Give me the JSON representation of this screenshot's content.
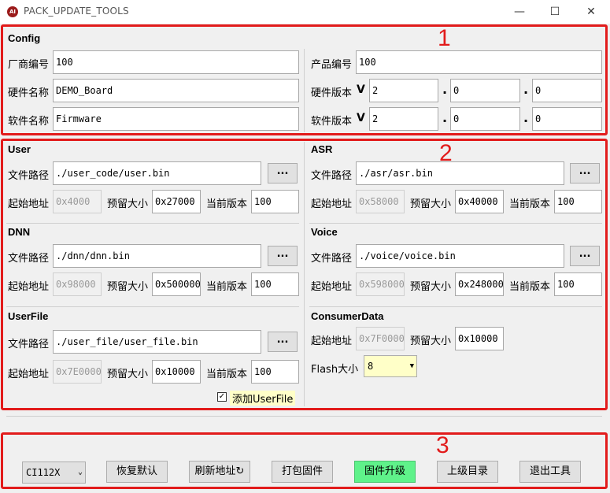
{
  "window": {
    "title": "PACK_UPDATE_TOOLS",
    "icon_text": "AI",
    "minimize": "—",
    "maximize": "☐",
    "close": "✕"
  },
  "markers": {
    "one": "1",
    "two": "2",
    "three": "3"
  },
  "config": {
    "title": "Config",
    "vendor_label": "厂商编号",
    "vendor_value": "100",
    "product_label": "产品编号",
    "product_value": "100",
    "hw_name_label": "硬件名称",
    "hw_name_value": "DEMO_Board",
    "hw_ver_label": "硬件版本",
    "hw_ver_v": "V",
    "hw_ver": [
      "2",
      "0",
      "0"
    ],
    "sw_name_label": "软件名称",
    "sw_name_value": "Firmware",
    "sw_ver_label": "软件版本",
    "sw_ver_v": "V",
    "sw_ver": [
      "2",
      "0",
      "0"
    ],
    "dot": "."
  },
  "labels": {
    "path": "文件路径",
    "start": "起始地址",
    "reserve": "预留大小",
    "version": "当前版本",
    "browse": "...",
    "flash": "Flash大小"
  },
  "user": {
    "title": "User",
    "path": "./user_code/user.bin",
    "start": "0x4000",
    "reserve": "0x27000",
    "version": "100"
  },
  "asr": {
    "title": "ASR",
    "path": "./asr/asr.bin",
    "start": "0x58000",
    "reserve": "0x40000",
    "version": "100"
  },
  "dnn": {
    "title": "DNN",
    "path": "./dnn/dnn.bin",
    "start": "0x98000",
    "reserve": "0x500000",
    "version": "100"
  },
  "voice": {
    "title": "Voice",
    "path": "./voice/voice.bin",
    "start": "0x598000",
    "reserve": "0x248000",
    "version": "100"
  },
  "userfile": {
    "title": "UserFile",
    "path": "./user_file/user_file.bin",
    "start": "0x7E0000",
    "reserve": "0x10000",
    "version": "100",
    "add_label": "添加UserFile",
    "add_checked": "✓"
  },
  "consumer": {
    "title": "ConsumerData",
    "start": "0x7F0000",
    "reserve": "0x10000",
    "flash_value": "8"
  },
  "bottom": {
    "chip": "CI112X",
    "restore": "恢复默认",
    "refresh": "刷新地址↻",
    "pack": "打包固件",
    "upgrade": "固件升级",
    "parent": "上级目录",
    "exit": "退出工具"
  },
  "colors": {
    "highlight_red": "#e21b1b",
    "upgrade_green": "#5ff28a",
    "combo_yellow": "#ffffc8"
  }
}
